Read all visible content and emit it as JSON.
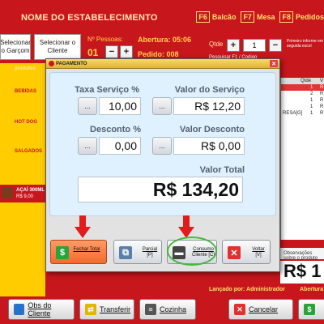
{
  "header": {
    "establishment": "NOME DO ESTABELECIMENTO",
    "fkeys": [
      {
        "key": "F6",
        "label": "Balcão"
      },
      {
        "key": "F7",
        "label": "Mesa"
      },
      {
        "key": "F8",
        "label": "Pedidos"
      }
    ]
  },
  "info": {
    "select_waiter": "Selecionar o Garçom",
    "select_client": "Selecionar o Cliente",
    "pessoas_label": "Nº Pessoas:",
    "pessoas_value": "01",
    "abertura_label": "Abertura: 05:06",
    "pedido_label": "Pedido: 008",
    "minus": "−",
    "plus": "+"
  },
  "qtde": {
    "label": "Qtde",
    "plus": "+",
    "value": "1",
    "minus": "−",
    "hint": "Primeiro informe em seguida escol",
    "search_hint": "Pesquisar F1 / Codigo"
  },
  "categories": [
    "produtos",
    "BEBIDAS",
    "HOT DOG",
    "SALGADOS"
  ],
  "product": {
    "name": "AÇAÍ 300ML",
    "price": "R$ 9,00"
  },
  "right_list": {
    "headers": [
      "Qtde",
      "V"
    ],
    "rows": [
      {
        "qtde": "1",
        "v": "R"
      },
      {
        "qtde": "2",
        "v": "R"
      },
      {
        "qtde": "1",
        "v": "R"
      },
      {
        "qtde": "1",
        "v": "R"
      },
      {
        "qtde": "1",
        "v": "R"
      }
    ],
    "extra_text": "RESA[G]"
  },
  "bottom_msg": "Observações sobre o produto",
  "bottom_total": "R$ 1",
  "footer": {
    "lancado": "Lançado por: Administrador",
    "abertura": "Abertura"
  },
  "bottom_buttons": {
    "obs": "Obs do Cliente",
    "transferir": "Transferir",
    "cozinha": "Cozinha",
    "cancelar": "Cancelar"
  },
  "modal": {
    "title": "PAGAMENTO",
    "taxa_label": "Taxa Serviço %",
    "taxa_value": "10,00",
    "valor_servico_label": "Valor do Serviço",
    "valor_servico_value": "R$ 12,20",
    "desconto_label": "Desconto %",
    "desconto_value": "0,00",
    "valor_desconto_label": "Valor Desconto",
    "valor_desconto_value": "R$ 0,00",
    "valor_total_label": "Valor Total",
    "valor_total_value": "R$ 134,20",
    "dots": "...",
    "buttons": {
      "fechar": "Fechar Total",
      "parcial": "Parcial",
      "parcial_key": "[P]",
      "consumo": "Consumo",
      "consumo_key": "Cliente [C]",
      "voltar": "Voltar",
      "voltar_key": "[V]"
    }
  },
  "colors": {
    "primary_red": "#c8161d",
    "accent_yellow": "#ffcc00",
    "annotation_red": "#e21b1b",
    "annotation_green": "#46b83c"
  }
}
